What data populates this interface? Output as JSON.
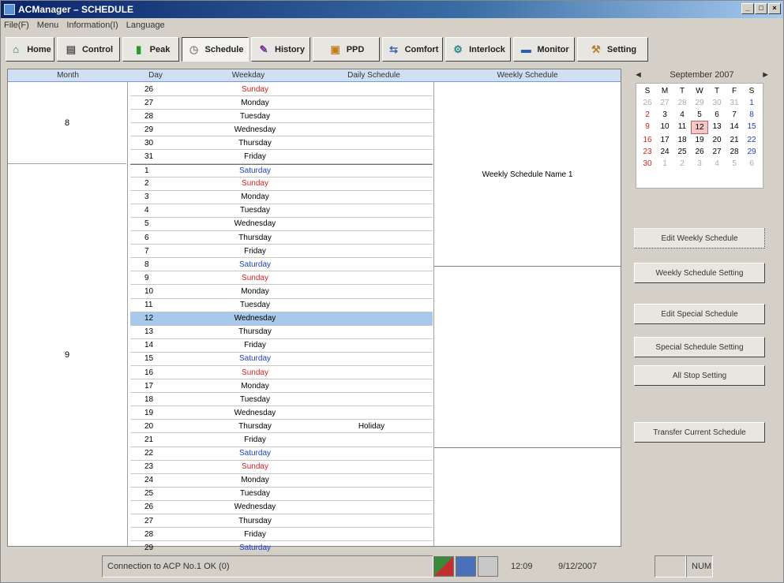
{
  "window": {
    "title": "ACManager – SCHEDULE",
    "controls": [
      "_",
      "□",
      "×"
    ]
  },
  "menu": [
    "File(F)",
    "Menu",
    "Information(I)",
    "Language"
  ],
  "toolbar": [
    {
      "id": "home",
      "label": "Home",
      "icon": "home-icon"
    },
    {
      "id": "control",
      "label": "Control",
      "icon": "control-icon"
    },
    {
      "id": "peak",
      "label": "Peak",
      "icon": "bar-chart-icon"
    },
    {
      "id": "schedule",
      "label": "Schedule",
      "icon": "clock-icon",
      "active": true
    },
    {
      "id": "history",
      "label": "History",
      "icon": "pencil-icon"
    },
    {
      "id": "ppd",
      "label": "PPD",
      "icon": "ppd-icon"
    },
    {
      "id": "comfort",
      "label": "Comfort",
      "icon": "comfort-icon"
    },
    {
      "id": "interlock",
      "label": "Interlock",
      "icon": "interlock-icon"
    },
    {
      "id": "monitor",
      "label": "Monitor",
      "icon": "monitor-icon"
    },
    {
      "id": "setting",
      "label": "Setting",
      "icon": "wrench-icon"
    }
  ],
  "table": {
    "headers": {
      "month": "Month",
      "day": "Day",
      "weekday": "Weekday",
      "daily": "Daily Schedule",
      "weekly": "Weekly Schedule"
    },
    "months": [
      {
        "label": "8"
      },
      {
        "label": "9"
      }
    ],
    "rows": [
      {
        "day": "26",
        "weekday": "Sunday",
        "color": "#d02020"
      },
      {
        "day": "27",
        "weekday": "Monday"
      },
      {
        "day": "28",
        "weekday": "Tuesday"
      },
      {
        "day": "29",
        "weekday": "Wednesday"
      },
      {
        "day": "30",
        "weekday": "Thursday"
      },
      {
        "day": "31",
        "weekday": "Friday"
      },
      {
        "day": "1",
        "weekday": "Saturday",
        "color": "#2040c0"
      },
      {
        "day": "2",
        "weekday": "Sunday",
        "color": "#d02020"
      },
      {
        "day": "3",
        "weekday": "Monday"
      },
      {
        "day": "4",
        "weekday": "Tuesday"
      },
      {
        "day": "5",
        "weekday": "Wednesday"
      },
      {
        "day": "6",
        "weekday": "Thursday"
      },
      {
        "day": "7",
        "weekday": "Friday"
      },
      {
        "day": "8",
        "weekday": "Saturday",
        "color": "#2040c0"
      },
      {
        "day": "9",
        "weekday": "Sunday",
        "color": "#d02020"
      },
      {
        "day": "10",
        "weekday": "Monday"
      },
      {
        "day": "11",
        "weekday": "Tuesday"
      },
      {
        "day": "12",
        "weekday": "Wednesday",
        "selected": true
      },
      {
        "day": "13",
        "weekday": "Thursday"
      },
      {
        "day": "14",
        "weekday": "Friday"
      },
      {
        "day": "15",
        "weekday": "Saturday",
        "color": "#2040c0"
      },
      {
        "day": "16",
        "weekday": "Sunday",
        "color": "#d02020"
      },
      {
        "day": "17",
        "weekday": "Monday"
      },
      {
        "day": "18",
        "weekday": "Tuesday"
      },
      {
        "day": "19",
        "weekday": "Wednesday"
      },
      {
        "day": "20",
        "weekday": "Thursday",
        "daily": "Holiday"
      },
      {
        "day": "21",
        "weekday": "Friday"
      },
      {
        "day": "22",
        "weekday": "Saturday",
        "color": "#2040c0"
      },
      {
        "day": "23",
        "weekday": "Sunday",
        "color": "#d02020"
      },
      {
        "day": "24",
        "weekday": "Monday"
      },
      {
        "day": "25",
        "weekday": "Tuesday"
      },
      {
        "day": "26",
        "weekday": "Wednesday"
      },
      {
        "day": "27",
        "weekday": "Thursday"
      },
      {
        "day": "28",
        "weekday": "Friday"
      },
      {
        "day": "29",
        "weekday": "Saturday",
        "color": "#2040c0"
      }
    ],
    "weekly_label": "Weekly Schedule Name 1"
  },
  "calendar": {
    "title": "September 2007",
    "prev": "◄",
    "next": "►",
    "dow": [
      "S",
      "M",
      "T",
      "W",
      "T",
      "F",
      "S"
    ],
    "cells": [
      [
        "26",
        "grey"
      ],
      [
        "27",
        "grey"
      ],
      [
        "28",
        "grey"
      ],
      [
        "29",
        "grey"
      ],
      [
        "30",
        "grey"
      ],
      [
        "31",
        "grey"
      ],
      [
        "1",
        "blue"
      ],
      [
        "2",
        "red"
      ],
      [
        "3",
        ""
      ],
      [
        "4",
        ""
      ],
      [
        "5",
        ""
      ],
      [
        "6",
        ""
      ],
      [
        "7",
        ""
      ],
      [
        "8",
        "blue"
      ],
      [
        "9",
        "red"
      ],
      [
        "10",
        ""
      ],
      [
        "11",
        ""
      ],
      [
        "12",
        "today"
      ],
      [
        "13",
        ""
      ],
      [
        "14",
        ""
      ],
      [
        "15",
        "blue"
      ],
      [
        "16",
        "red"
      ],
      [
        "17",
        ""
      ],
      [
        "18",
        ""
      ],
      [
        "19",
        ""
      ],
      [
        "20",
        ""
      ],
      [
        "21",
        ""
      ],
      [
        "22",
        "blue"
      ],
      [
        "23",
        "red"
      ],
      [
        "24",
        ""
      ],
      [
        "25",
        ""
      ],
      [
        "26",
        ""
      ],
      [
        "27",
        ""
      ],
      [
        "28",
        ""
      ],
      [
        "29",
        "blue"
      ],
      [
        "30",
        "red"
      ],
      [
        "1",
        "grey"
      ],
      [
        "2",
        "grey"
      ],
      [
        "3",
        "grey"
      ],
      [
        "4",
        "grey"
      ],
      [
        "5",
        "grey"
      ],
      [
        "6",
        "grey"
      ]
    ]
  },
  "side_buttons": [
    "Edit Weekly Schedule",
    "Weekly Schedule Setting",
    "Edit Special Schedule",
    "Special Schedule Setting",
    "All Stop Setting",
    "Transfer Current Schedule"
  ],
  "status": {
    "connection": "Connection to ACP No.1 OK (0)",
    "time": "12:09",
    "date": "9/12/2007",
    "mode": "NUM"
  }
}
